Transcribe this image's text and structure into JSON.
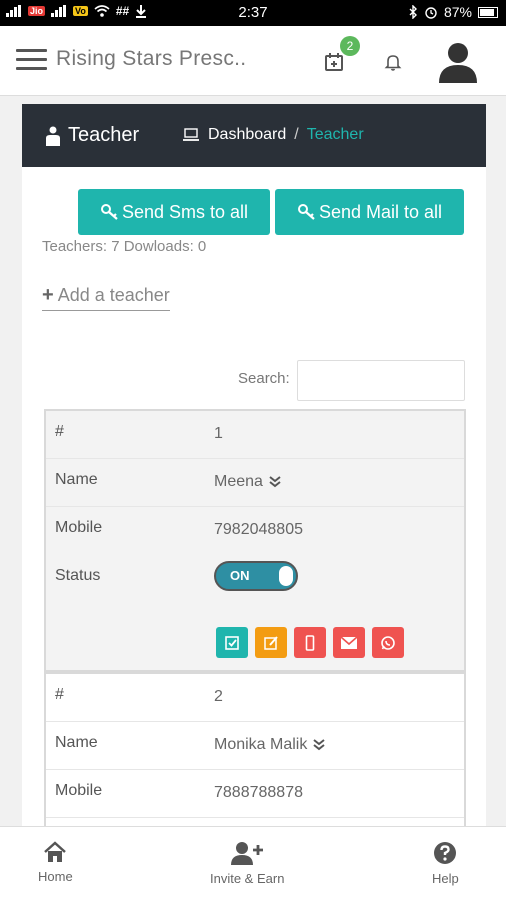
{
  "status_bar": {
    "carrier_tags": [
      "Jio",
      "Vo"
    ],
    "network_mark": "##",
    "time": "2:37",
    "battery": "87%",
    "icons": [
      "signal-icon",
      "wifi-icon",
      "download-icon",
      "bluetooth-icon",
      "alarm-icon",
      "battery-icon"
    ]
  },
  "app_bar": {
    "title": "Rising Stars Presc..",
    "calendar_badge": "2",
    "icons": [
      "menu-icon",
      "calendar-icon",
      "bell-icon",
      "user-avatar-icon"
    ]
  },
  "card": {
    "title": "Teacher",
    "breadcrumb": {
      "home": "Dashboard",
      "separator": "/",
      "current": "Teacher"
    },
    "buttons": {
      "sms": "Send Sms to all",
      "mail": "Send Mail to all"
    },
    "counts": "Teachers: 7 Dowloads: 0",
    "add_teacher": "Add a teacher",
    "search_label": "Search:",
    "search_value": ""
  },
  "records": [
    {
      "hash_label": "#",
      "index": "1",
      "name_label": "Name",
      "name": "Meena",
      "mobile_label": "Mobile",
      "mobile": "7982048805",
      "status_label": "Status",
      "status": "ON"
    },
    {
      "hash_label": "#",
      "index": "2",
      "name_label": "Name",
      "name": "Monika Malik",
      "mobile_label": "Mobile",
      "mobile": "7888788878"
    }
  ],
  "bottom_nav": {
    "home": "Home",
    "invite": "Invite & Earn",
    "help": "Help"
  },
  "colors": {
    "accent": "#1fb5ad",
    "header_dark": "#2a3038",
    "badge_green": "#5cb85c",
    "orange": "#f39c12",
    "red": "#ef5350"
  }
}
